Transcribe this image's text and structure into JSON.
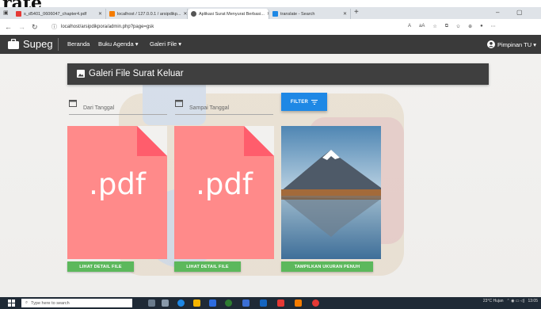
{
  "overlay": {
    "cropped_text": "rate"
  },
  "browser": {
    "tabs": [
      {
        "label": "s_d5401_0606047_chapter4.pdf",
        "active": false,
        "color": "#e53935"
      },
      {
        "label": "localhost / 127.0.0.1 / arsipdikp...",
        "active": false,
        "color": "#f57c00"
      },
      {
        "label": "Aplikasi Surat Menyurat Berbasi...",
        "active": true,
        "color": "#555555"
      },
      {
        "label": "translate - Search",
        "active": false,
        "color": "#1e88e5"
      }
    ],
    "url": "localhost/arsipdikpora/admin.php?page=gsk",
    "new_tab": "+",
    "min": "–",
    "restore": "▢"
  },
  "app": {
    "brand": "Supeg",
    "nav": [
      {
        "label": "Beranda"
      },
      {
        "label": "Buku Agenda ▾"
      },
      {
        "label": "Galeri File ▾"
      }
    ],
    "user": "Pimpinan TU ▾",
    "page_title": "Galeri File Surat Keluar",
    "filters": {
      "from": "Dari Tanggal",
      "to": "Sampai Tanggal",
      "button": "FILTER"
    },
    "files": [
      {
        "type": "pdf",
        "ext": ".pdf",
        "action": "LIHAT DETAIL FILE"
      },
      {
        "type": "pdf",
        "ext": ".pdf",
        "action": "LIHAT DETAIL FILE"
      },
      {
        "type": "image",
        "action": "TAMPILKAN UKURAN PENUH"
      }
    ],
    "colors": {
      "navbar": "#3a3a3a",
      "pdf": "#ff8a8a",
      "filter": "#1e88e5",
      "action": "#5cb85c"
    }
  },
  "taskbar": {
    "search_placeholder": "Type here to search",
    "weather": "23°C Hujan",
    "time": "13:05"
  }
}
